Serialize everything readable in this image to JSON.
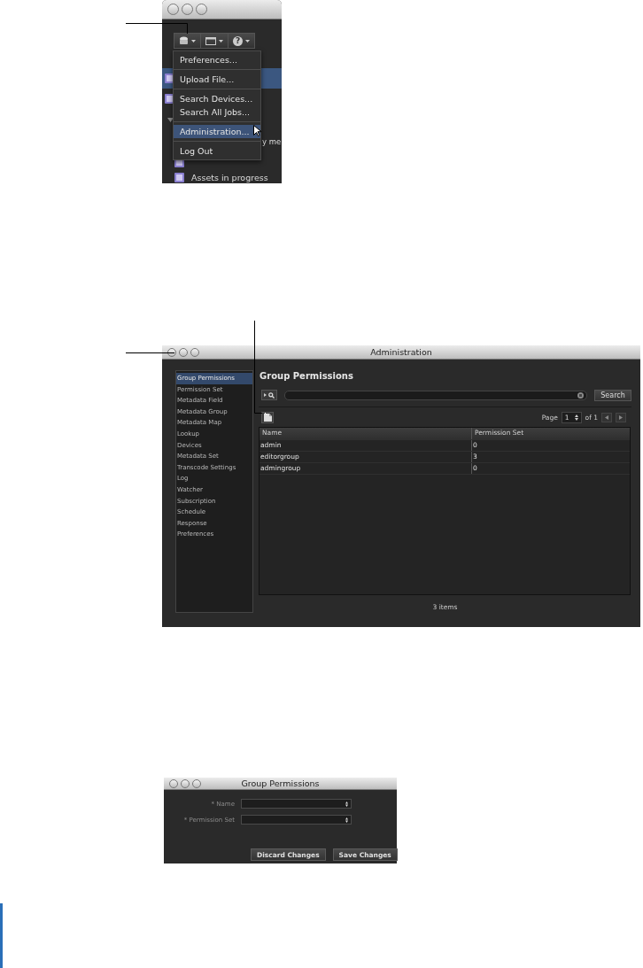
{
  "menu_window": {
    "toolbar": [
      {
        "kind": "stack"
      },
      {
        "kind": "window"
      },
      {
        "kind": "help",
        "glyph": "?"
      }
    ],
    "background_rows": [
      {
        "kind": "icon",
        "selected": true
      },
      {
        "kind": "icon",
        "selected": false
      },
      {
        "kind": "disclosure",
        "selected": false
      },
      {
        "kind": "tail",
        "selected": false,
        "text": "y me"
      },
      {
        "kind": "icon",
        "selected": false
      },
      {
        "kind": "icon",
        "selected": false,
        "text": "Assets in progress"
      }
    ],
    "menu_groups": [
      [
        {
          "label": "Preferences...",
          "selected": false
        }
      ],
      [
        {
          "label": "Upload File...",
          "selected": false
        }
      ],
      [
        {
          "label": "Search Devices...",
          "selected": false
        },
        {
          "label": "Search All Jobs...",
          "selected": false
        }
      ],
      [
        {
          "label": "Administration...",
          "selected": true
        }
      ],
      [
        {
          "label": "Log Out",
          "selected": false
        }
      ]
    ]
  },
  "admin_window": {
    "title": "Administration",
    "sidebar": [
      {
        "label": "Group Permissions",
        "selected": true
      },
      {
        "label": "Permission Set",
        "selected": false
      },
      {
        "label": "Metadata Field",
        "selected": false
      },
      {
        "label": "Metadata Group",
        "selected": false
      },
      {
        "label": "Metadata Map",
        "selected": false
      },
      {
        "label": "Lookup",
        "selected": false
      },
      {
        "label": "Devices",
        "selected": false
      },
      {
        "label": "Metadata Set",
        "selected": false
      },
      {
        "label": "Transcode Settings",
        "selected": false
      },
      {
        "label": "Log",
        "selected": false
      },
      {
        "label": "Watcher",
        "selected": false
      },
      {
        "label": "Subscription",
        "selected": false
      },
      {
        "label": "Schedule",
        "selected": false
      },
      {
        "label": "Response",
        "selected": false
      },
      {
        "label": "Preferences",
        "selected": false
      }
    ],
    "heading": "Group Permissions",
    "search_button": "Search",
    "pager": {
      "label": "Page",
      "page": "1",
      "of": "of 1"
    },
    "table": {
      "columns": [
        "Name",
        "Permission Set"
      ],
      "rows": [
        [
          "admin",
          "0"
        ],
        [
          "editorgroup",
          "3"
        ],
        [
          "admingroup",
          "0"
        ]
      ]
    },
    "footer": "3 items"
  },
  "form_window": {
    "title": "Group Permissions",
    "fields": [
      {
        "label": "* Name"
      },
      {
        "label": "* Permission Set"
      }
    ],
    "buttons": [
      "Discard Changes",
      "Save Changes"
    ]
  }
}
